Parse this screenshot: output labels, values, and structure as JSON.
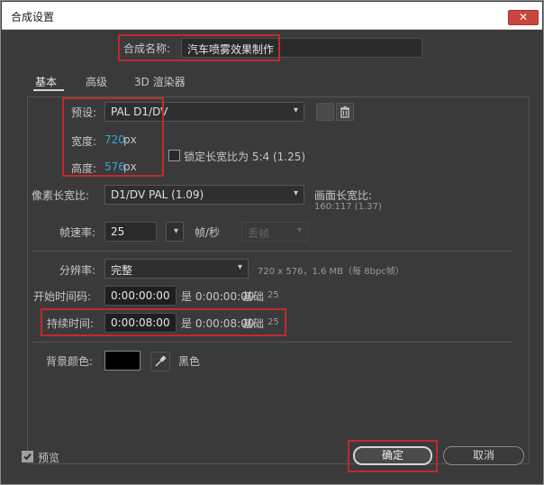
{
  "window": {
    "title": "合成设置",
    "close_glyph": "✕"
  },
  "comp_name": {
    "label": "合成名称:",
    "value": "汽车喷雾效果制作"
  },
  "tabs": [
    {
      "label": "基本",
      "active": true
    },
    {
      "label": "高级",
      "active": false
    },
    {
      "label": "3D 渲染器",
      "active": false
    }
  ],
  "preset": {
    "label": "预设:",
    "value": "PAL D1/DV"
  },
  "width": {
    "label": "宽度:",
    "value": "720",
    "unit": "px"
  },
  "height": {
    "label": "高度:",
    "value": "576",
    "unit": "px"
  },
  "lock_aspect": {
    "label": "锁定长宽比为 5:4 (1.25)",
    "checked": false
  },
  "pixel_aspect": {
    "label": "像素长宽比:",
    "value": "D1/DV PAL (1.09)"
  },
  "frame_aspect": {
    "label": "画面长宽比:",
    "value": "160:117 (1.37)"
  },
  "frame_rate": {
    "label": "帧速率:",
    "value": "25",
    "unit": "帧/秒",
    "drop_frame": "丢帧"
  },
  "resolution": {
    "label": "分辨率:",
    "value": "完整",
    "info": "720 x 576，1.6 MB（每 8bpc帧）"
  },
  "start_timecode": {
    "label": "开始时间码:",
    "value": "0:00:00:00",
    "is_text": "是 0:00:00:00",
    "base": "基础",
    "base_value": "25"
  },
  "duration": {
    "label": "持续时间:",
    "value": "0:00:08:00",
    "is_text": "是 0:00:08:00",
    "base": "基础",
    "base_value": "25"
  },
  "background_color": {
    "label": "背景颜色:",
    "name": "黑色",
    "color": "#000000"
  },
  "preview": {
    "label": "预览",
    "checked": true
  },
  "buttons": {
    "ok": "确定",
    "cancel": "取消"
  },
  "icons": {
    "save_preset": "save-preset-icon",
    "delete_preset": "trash-icon",
    "eyedropper": "eyedropper-icon",
    "dropdown": "chevron-down-icon"
  },
  "colors": {
    "accent_value": "#33a7d3",
    "highlight_box": "#c12a2a",
    "close_button": "#c9463f"
  }
}
